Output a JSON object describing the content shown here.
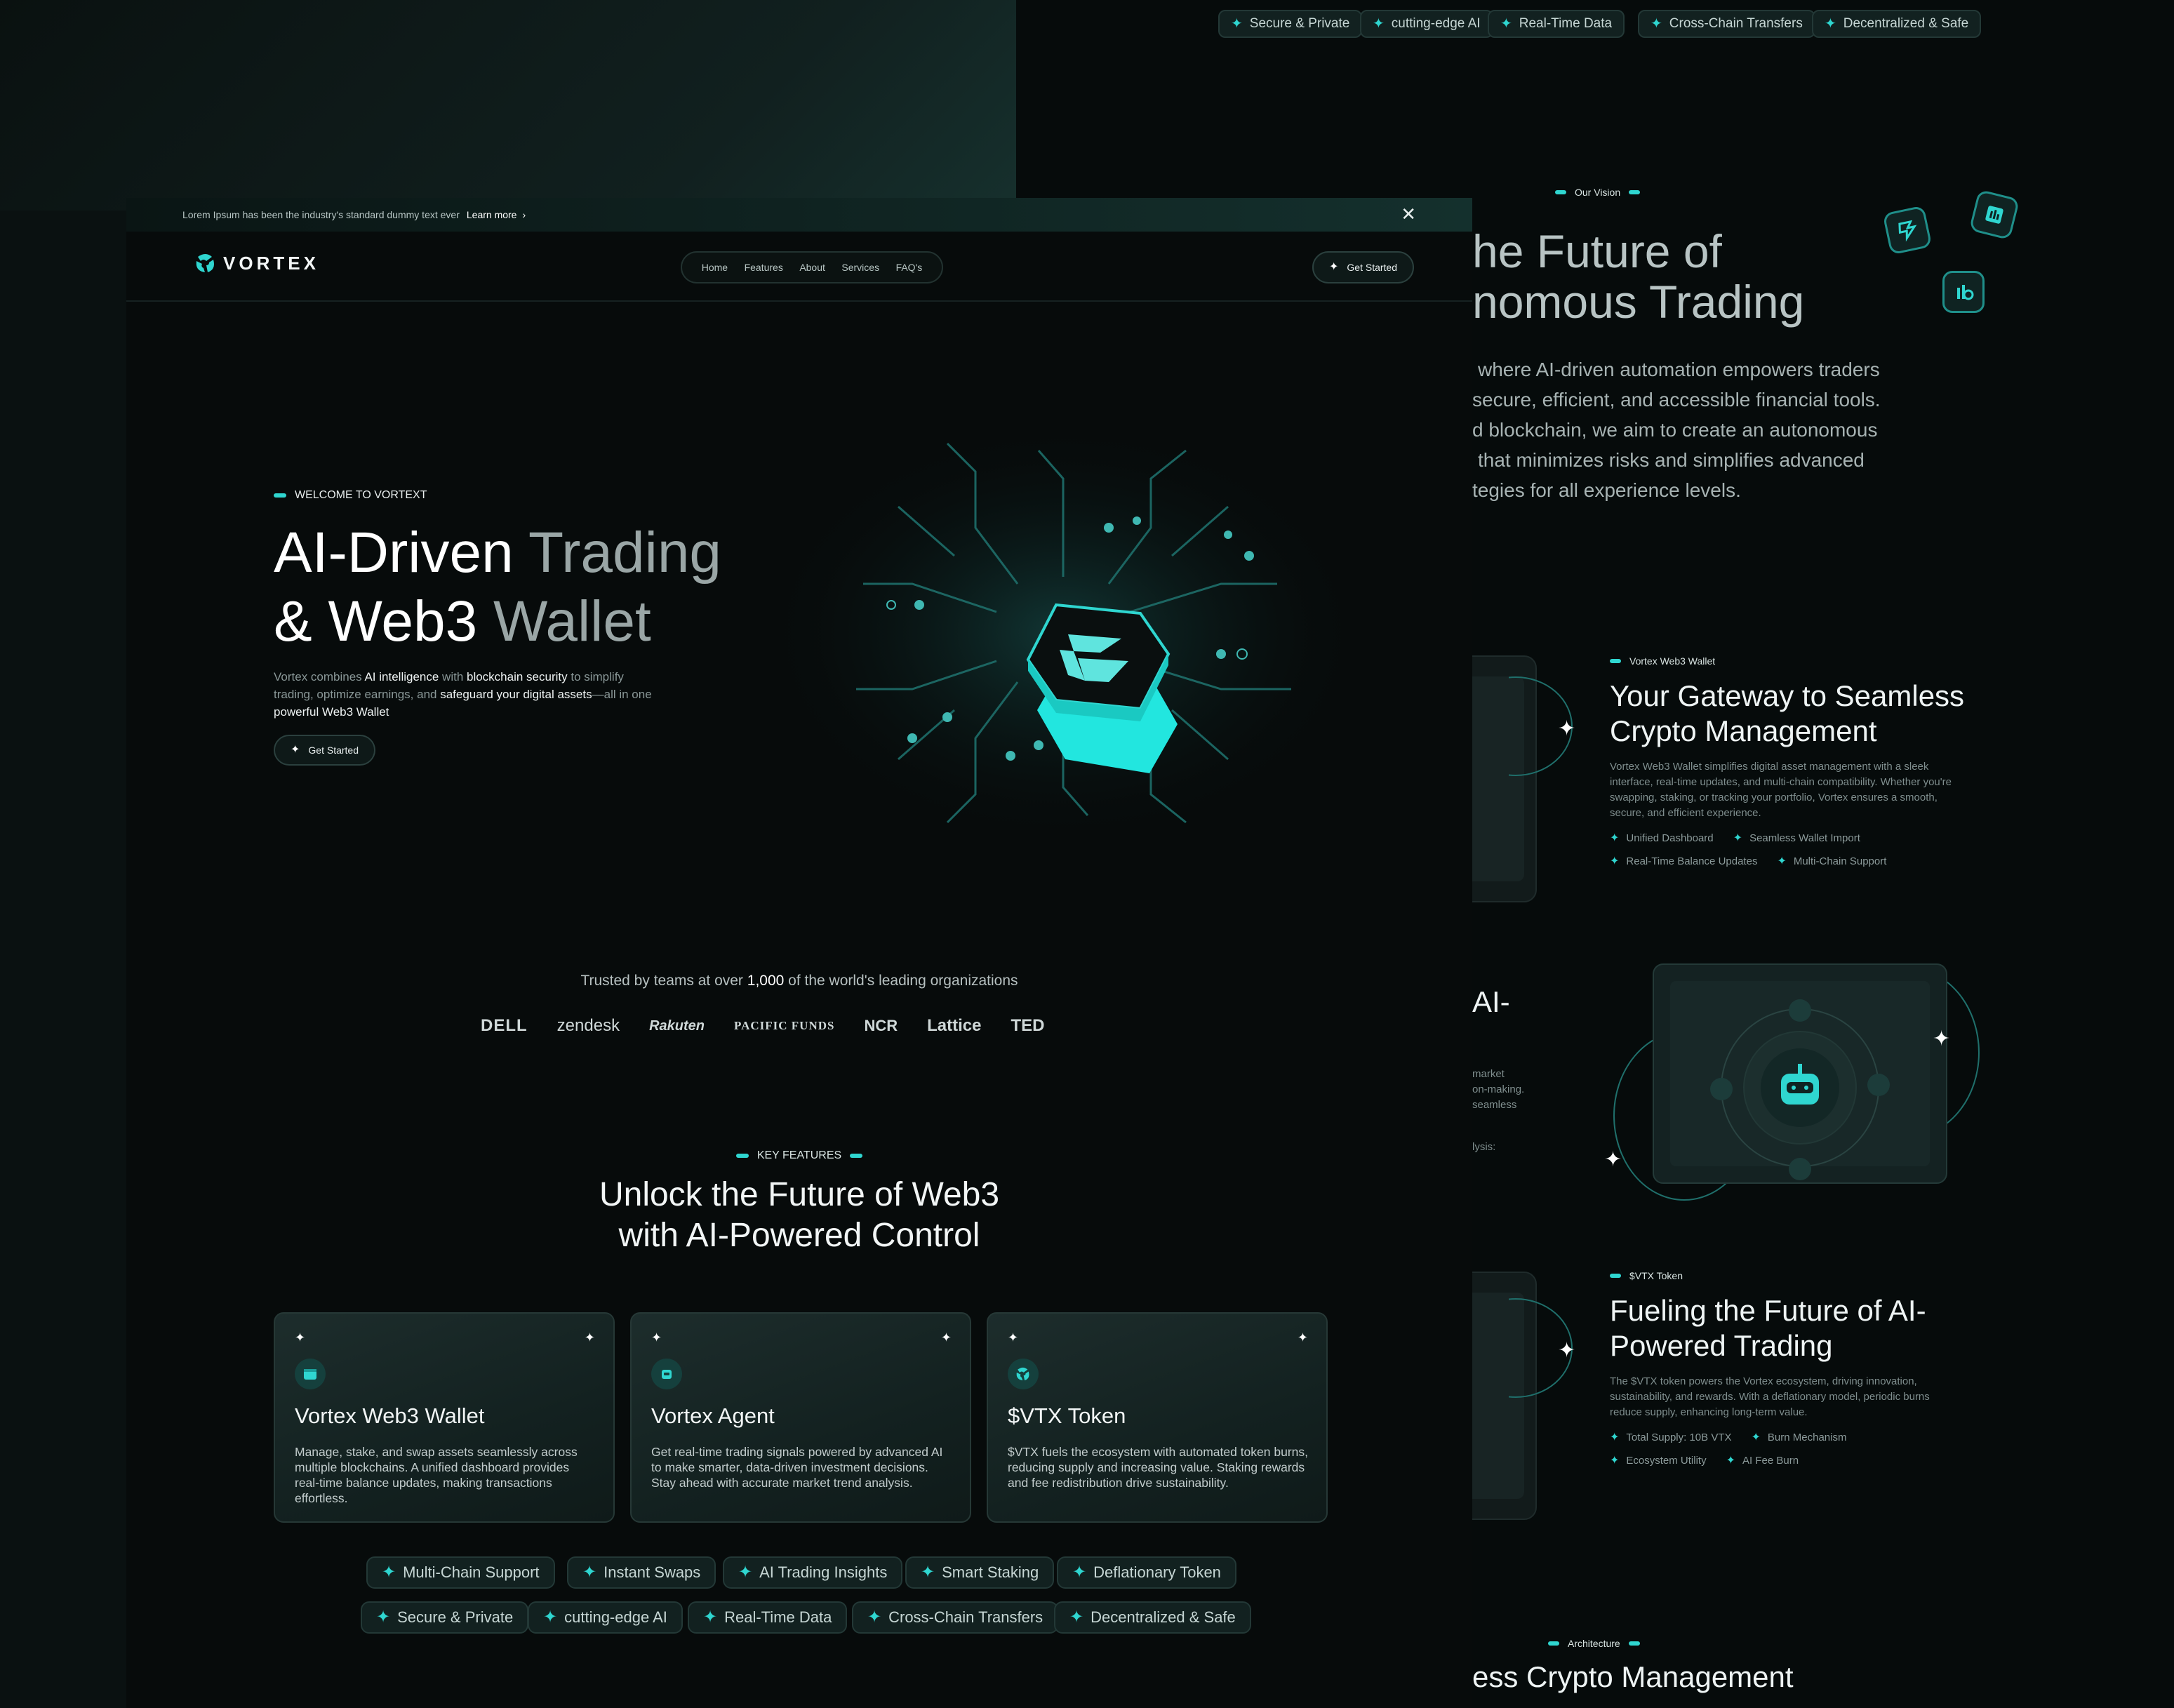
{
  "top_pills": [
    "Secure & Private",
    "cutting-edge AI",
    "Real-Time Data",
    "Cross-Chain Transfers",
    "Decentralized & Safe"
  ],
  "vision": {
    "tag": "Our Vision",
    "heading_lines": [
      "he Future of",
      "nomous Trading"
    ],
    "para_lines": [
      "where AI-driven automation empowers traders",
      "secure, efficient, and accessible financial tools.",
      "d blockchain, we aim to create an autonomous",
      "that minimizes risks and simplifies advanced",
      "tegies for all experience levels."
    ]
  },
  "wallet_section": {
    "tag": "Vortex Web3 Wallet",
    "title": "Your Gateway to Seamless Crypto Management",
    "desc": "Vortex Web3 Wallet simplifies digital asset management with a sleek interface, real-time updates, and multi-chain compatibility. Whether you're swapping, staking, or tracking your portfolio, Vortex ensures a smooth, secure, and efficient experience.",
    "features": [
      "Unified Dashboard",
      "Seamless Wallet Import",
      "Real-Time Balance Updates",
      "Multi-Chain Support"
    ]
  },
  "agent_section": {
    "title_fragment": "AI-",
    "desc_lines": [
      "market",
      "on-making.",
      "seamless"
    ],
    "analysis_fragment": "lysis:"
  },
  "token_section": {
    "tag": "$VTX Token",
    "title": "Fueling the Future of AI-Powered Trading",
    "desc": "The $VTX token powers the Vortex ecosystem, driving innovation, sustainability, and rewards. With a deflationary model, periodic burns reduce supply, enhancing long-term value.",
    "features": [
      "Total Supply: 10B VTX",
      "Burn Mechanism",
      "Ecosystem Utility",
      "AI Fee Burn"
    ]
  },
  "architecture": {
    "tag": "Architecture",
    "heading_fragment": "ess Crypto Management"
  },
  "announcement": {
    "text": "Lorem Ipsum has been the industry's standard dummy text ever",
    "link": "Learn more",
    "link_chevron": "›",
    "close_glyph": "✕"
  },
  "nav": {
    "logo_text": "VORTEX",
    "links": [
      "Home",
      "Features",
      "About",
      "Services",
      "FAQ's"
    ],
    "cta": "Get Started"
  },
  "hero": {
    "tag": "WELCOME TO VORTEXT",
    "line1_bright": "AI-Driven",
    "line1_dim": "Trading",
    "line2_bright": "& Web3",
    "line2_dim": "Wallet",
    "desc_parts": [
      "Vortex combines ",
      "AI intelligence",
      " with ",
      "blockchain security",
      " to simplify trading, optimize earnings, and ",
      "safeguard your digital assets",
      "—all in one ",
      "powerful Web3 Wallet"
    ],
    "cta": "Get Started"
  },
  "trusted": {
    "before": "Trusted by teams at over ",
    "count": "1,000",
    "after": " of the world's leading organizations",
    "logos": [
      "DELL",
      "zendesk",
      "Rakuten",
      "PACIFIC FUNDS",
      "NCR",
      "Lattice",
      "TED"
    ]
  },
  "features": {
    "tag": "KEY FEATURES",
    "heading_lines": [
      "Unlock the Future of Web3",
      "with AI-Powered Control"
    ],
    "cards": [
      {
        "icon": "wallet-icon",
        "title": "Vortex Web3 Wallet",
        "desc": "Manage, stake, and swap assets seamlessly across multiple blockchains. A unified dashboard provides real-time balance updates, making transactions effortless."
      },
      {
        "icon": "robot-icon",
        "title": "Vortex Agent",
        "desc": "Get real-time trading signals powered by advanced AI to make smarter, data-driven investment decisions. Stay ahead with accurate market trend analysis."
      },
      {
        "icon": "token-icon",
        "title": "$VTX Token",
        "desc": "$VTX fuels the ecosystem with automated token burns, reducing supply and increasing value. Staking rewards and fee redistribution drive sustainability."
      }
    ],
    "pills_row1": [
      "Multi-Chain Support",
      "Instant Swaps",
      "AI Trading Insights",
      "Smart Staking",
      "Deflationary Token"
    ],
    "pills_row2": [
      "Secure & Private",
      "cutting-edge AI",
      "Real-Time Data",
      "Cross-Chain Transfers",
      "Decentralized & Safe"
    ]
  },
  "colors": {
    "accent": "#2fd6d0",
    "background": "#070b0b",
    "card": "#16302d"
  }
}
